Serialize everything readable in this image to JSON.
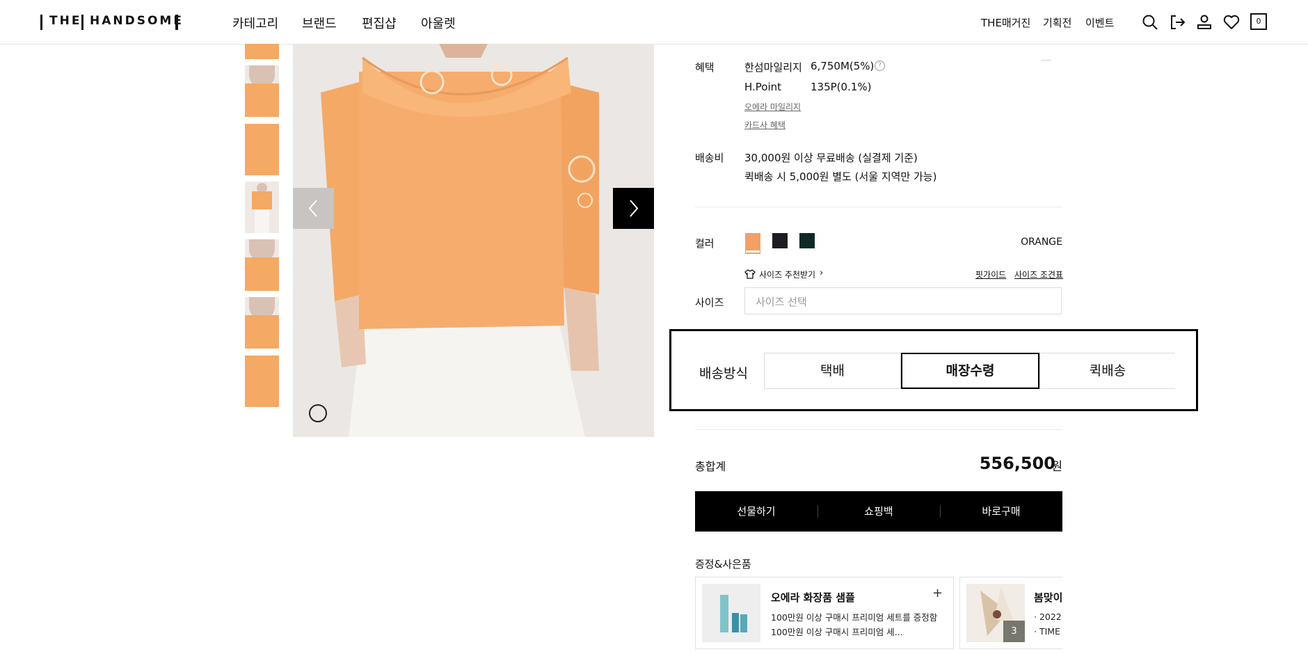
{
  "header": {
    "logo_left": "THE",
    "logo_right": "HANDSOME",
    "nav": [
      "카테고리",
      "브랜드",
      "편집샵",
      "아울렛"
    ],
    "util": [
      "THE매거진",
      "기획전",
      "이벤트"
    ],
    "cart_count": "0"
  },
  "benefit": {
    "label": "혜택",
    "rows": [
      {
        "name": "한섬마일리지",
        "value": "6,750M(5%)"
      },
      {
        "name": "H.Point",
        "value": "135P(0.1%)"
      }
    ],
    "links": [
      "오에라 마일리지",
      "카드사 혜택"
    ]
  },
  "shipping_fee": {
    "label": "배송비",
    "lines": [
      "30,000원 이상 무료배송 (실결제 기준)",
      "퀵배송 시 5,000원 별도 (서울 지역만 가능)"
    ]
  },
  "color": {
    "label": "컬러",
    "selected": "ORANGE",
    "swatches": [
      "#f2a063",
      "#1c1e22",
      "#0d2a24"
    ]
  },
  "size": {
    "recommend": "사이즈 추천받기",
    "fit_guide": "핏가이드",
    "size_chart": "사이즈 조견표",
    "label": "사이즈",
    "placeholder": "사이즈 선택"
  },
  "delivery": {
    "label": "배송방식",
    "options": [
      "택배",
      "매장수령",
      "퀵배송"
    ],
    "selected": "매장수령"
  },
  "total": {
    "label": "총합계",
    "amount": "556,500",
    "unit": "원"
  },
  "actions": [
    "선물하기",
    "쇼핑백",
    "바로구매"
  ],
  "gifts": {
    "title": "증정&사은품",
    "items": [
      {
        "name": "오에라 화장품 샘플",
        "desc1": "100만원 이상 구매시 프리미엄 세트를 증정함",
        "desc2": "100만원 이상 구매시 프리미엄 세..."
      },
      {
        "name": "봄맞이",
        "desc1": "· 2022",
        "desc2": "· TIME",
        "badge": "3"
      }
    ]
  },
  "colors": {
    "accent": "#000000",
    "text": "#111111",
    "muted": "#666666",
    "border": "#e2e2e2"
  }
}
